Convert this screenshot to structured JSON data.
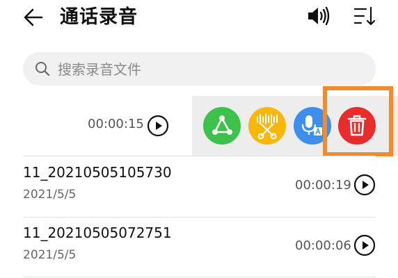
{
  "header": {
    "title": "通话录音",
    "back_icon": "back-arrow-icon",
    "speaker_icon": "speaker-icon",
    "sort_icon": "sort-icon"
  },
  "search": {
    "placeholder": "搜索录音文件",
    "value": ""
  },
  "swiped_item": {
    "duration": "00:00:15",
    "actions": [
      {
        "name": "share",
        "icon": "share-icon",
        "color": "#3cc14a"
      },
      {
        "name": "trim",
        "icon": "trim-icon",
        "color": "#f9b809"
      },
      {
        "name": "transcribe",
        "icon": "voice-to-text-icon",
        "color": "#3d8fef"
      },
      {
        "name": "delete",
        "icon": "trash-icon",
        "color": "#ea2b2b"
      }
    ],
    "highlight_color": "#f38a2b"
  },
  "recordings": [
    {
      "name": "11_20210505105730",
      "date": "2021/5/5",
      "duration": "00:00:19"
    },
    {
      "name": "11_20210505072751",
      "date": "2021/5/5",
      "duration": "00:00:06"
    }
  ]
}
